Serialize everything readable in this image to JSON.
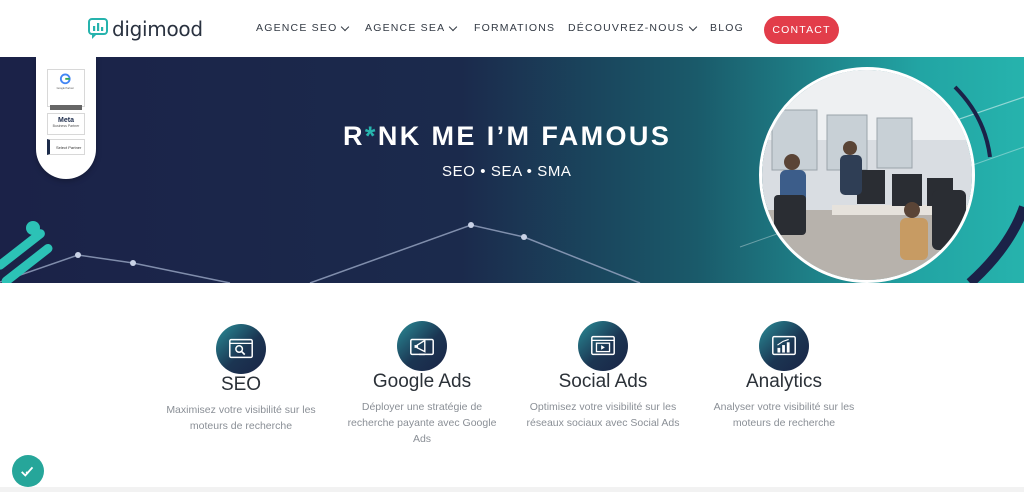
{
  "brand": {
    "name": "digimood",
    "accent": "#e23d4a",
    "teal": "#26b3ad",
    "navy": "#1b2248"
  },
  "nav": {
    "items": [
      {
        "label": "AGENCE SEO",
        "dropdown": true
      },
      {
        "label": "AGENCE SEA",
        "dropdown": true
      },
      {
        "label": "FORMATIONS",
        "dropdown": false
      },
      {
        "label": "DÉCOUVREZ-NOUS",
        "dropdown": true
      },
      {
        "label": "BLOG",
        "dropdown": false
      }
    ],
    "contact_label": "CONTACT"
  },
  "hero": {
    "title_prefix": "R",
    "title_star": "*",
    "title_suffix": "NK ME I’M FAMOUS",
    "subtitle": "SEO • SEA • SMA",
    "badges": [
      {
        "name": "google-partner-badge",
        "text": "Google Partner"
      },
      {
        "name": "meta-business-partner-badge",
        "text": "Meta",
        "subtext": "Business Partner"
      },
      {
        "name": "select-partner-badge",
        "text": "Select Partner"
      }
    ]
  },
  "services": [
    {
      "icon": "search-window-icon",
      "title": "SEO",
      "desc": "Maximisez votre visibilité sur les moteurs de recherche"
    },
    {
      "icon": "megaphone-screen-icon",
      "title": "Google Ads",
      "desc": "Déployer une stratégie de recherche payante avec Google Ads"
    },
    {
      "icon": "video-player-icon",
      "title": "Social Ads",
      "desc": "Optimisez votre visibilité sur les réseaux sociaux avec Social Ads"
    },
    {
      "icon": "bar-chart-window-icon",
      "title": "Analytics",
      "desc": "Analyser votre visibilité sur les moteurs de recherche"
    }
  ]
}
